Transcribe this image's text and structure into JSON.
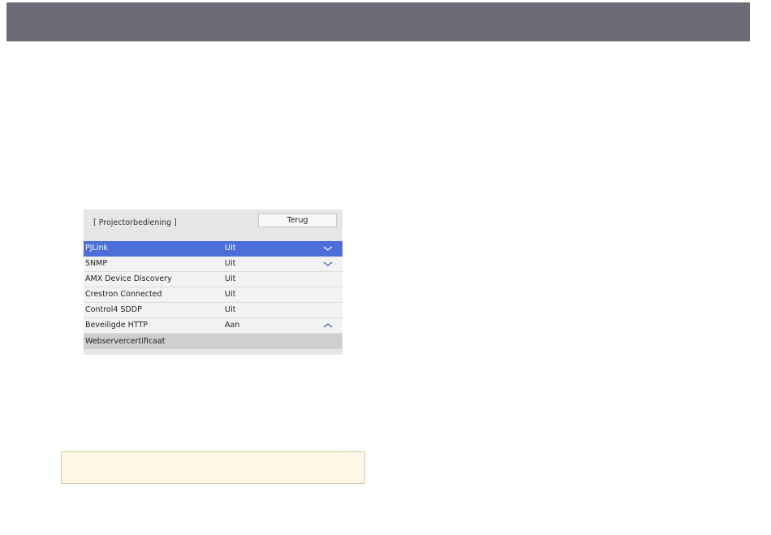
{
  "menu": {
    "title": "[ Projectorbediening ]",
    "back_label": "Terug",
    "rows": [
      {
        "label": "PJLink",
        "value": "Uit",
        "icon": "chevron-down-icon"
      },
      {
        "label": "SNMP",
        "value": "Uit",
        "icon": "chevron-down-icon"
      },
      {
        "label": "AMX Device Discovery",
        "value": "Uit"
      },
      {
        "label": "Crestron Connected",
        "value": "Uit"
      },
      {
        "label": "Control4 SDDP",
        "value": "Uit"
      },
      {
        "label": "Beveiligde HTTP",
        "value": "Aan",
        "icon": "chevron-up-icon"
      },
      {
        "label": "Webservercertificaat"
      }
    ]
  },
  "colors": {
    "top_bar": "#6b6c77",
    "selected_row": "#4b6ed8",
    "note_background": "#fff6e6",
    "note_border": "#d9c9a6"
  }
}
